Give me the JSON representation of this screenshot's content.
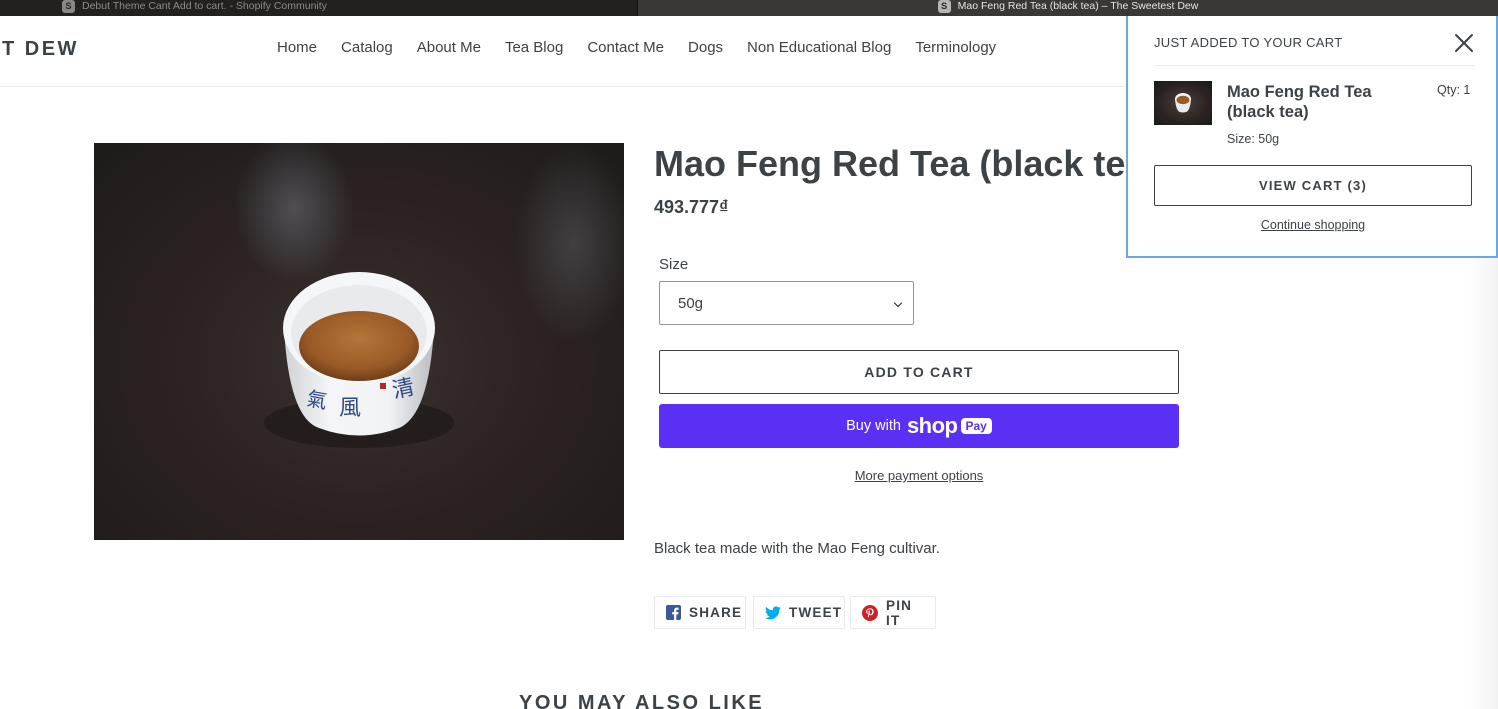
{
  "browser": {
    "tabs": [
      {
        "favicon": "S",
        "title": "Debut Theme Cant Add to cart. - Shopify Community"
      },
      {
        "favicon": "S",
        "title": "Mao Feng Red Tea (black tea) – The Sweetest Dew"
      }
    ]
  },
  "header": {
    "logo": "T DEW",
    "nav": [
      "Home",
      "Catalog",
      "About Me",
      "Tea Blog",
      "Contact Me",
      "Dogs",
      "Non Educational Blog",
      "Terminology"
    ]
  },
  "product": {
    "title": "Mao Feng Red Tea (black tea)",
    "price": "493.777₫",
    "size_label": "Size",
    "size_value": "50g",
    "add_to_cart": "ADD TO CART",
    "buy_with": "Buy with",
    "shop_word": "shop",
    "pay_word": "Pay",
    "more_payment": "More payment options",
    "description": "Black tea made with the Mao Feng cultivar."
  },
  "social": {
    "share": "SHARE",
    "tweet": "TWEET",
    "pin": "PIN IT"
  },
  "related": {
    "heading": "YOU MAY ALSO LIKE"
  },
  "cart_popup": {
    "heading": "JUST ADDED TO YOUR CART",
    "item_name": "Mao Feng Red Tea (black tea)",
    "qty": "Qty: 1",
    "size": "Size: 50g",
    "view_cart": "VIEW CART (3)",
    "continue": "Continue shopping"
  },
  "colors": {
    "text": "#3d4246",
    "shop_pay": "#5a31f4",
    "popup_border": "#6aa6e8",
    "facebook": "#3b5998",
    "twitter": "#00aced",
    "pinterest": "#cb2127"
  }
}
